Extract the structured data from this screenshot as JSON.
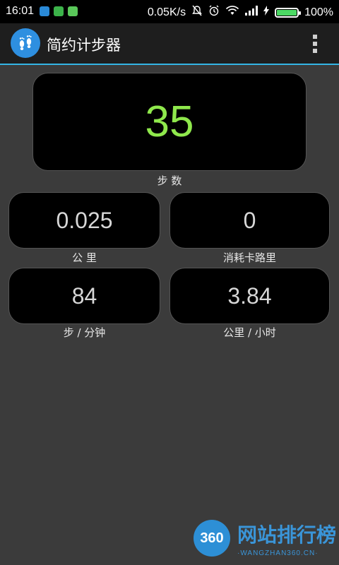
{
  "status_bar": {
    "time": "16:01",
    "network_speed": "0.05K/s",
    "battery_percent": "100%",
    "battery_level": 1.0,
    "icons": [
      "app-notification-icon-1",
      "app-notification-icon-2",
      "app-notification-icon-3",
      "mute-icon",
      "alarm-icon",
      "wifi-icon",
      "signal-icon",
      "charging-icon",
      "battery-icon"
    ]
  },
  "action_bar": {
    "title": "简约计步器",
    "app_icon": "footprints-icon",
    "menu_icon": "overflow-menu-icon"
  },
  "stats": {
    "steps": {
      "value": "35",
      "label": "步 数"
    },
    "distance": {
      "value": "0.025",
      "label": "公 里"
    },
    "calories": {
      "value": "0",
      "label": "消耗卡路里"
    },
    "pace": {
      "value": "84",
      "label": "步 / 分钟"
    },
    "speed": {
      "value": "3.84",
      "label": "公里 / 小时"
    }
  },
  "colors": {
    "accent": "#33b5e5",
    "steps_value": "#8fe84c",
    "background": "#3b3b3b"
  },
  "watermark": {
    "logo": "360",
    "text": "网站排行榜",
    "sub": "·WANGZHAN360.CN·"
  }
}
